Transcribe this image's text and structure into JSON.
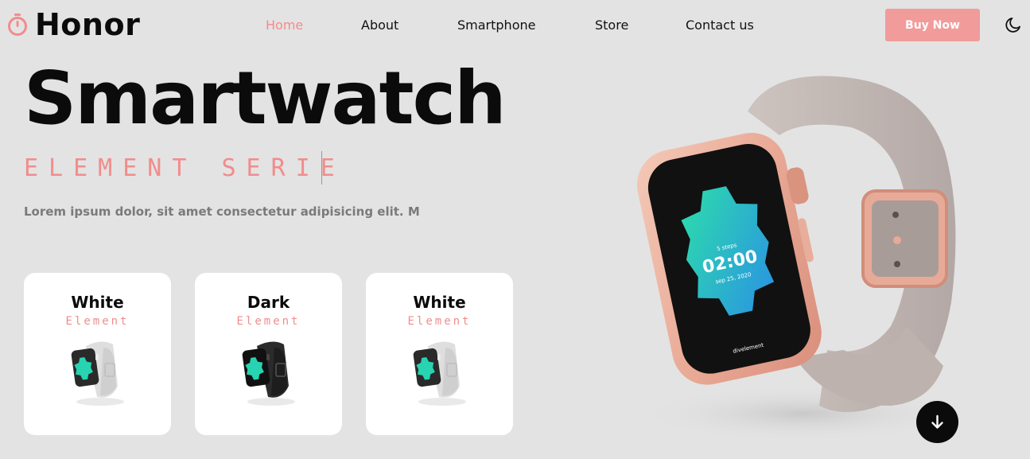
{
  "brand": {
    "name": "Honor",
    "accent": "#f28c8c"
  },
  "nav": {
    "items": [
      {
        "label": "Home",
        "active": true
      },
      {
        "label": "About",
        "active": false
      },
      {
        "label": "Smartphone",
        "active": false
      },
      {
        "label": "Store",
        "active": false
      },
      {
        "label": "Contact us",
        "active": false
      }
    ],
    "cta_label": "Buy Now",
    "theme_icon": "moon-icon"
  },
  "hero": {
    "title": "Smartwatch",
    "subtitle": "ELEMENT SERIE",
    "description": "Lorem ipsum dolor, sit amet consectetur adipisicing elit. M"
  },
  "cards": [
    {
      "title": "White",
      "subtitle": "Element",
      "band": "white"
    },
    {
      "title": "Dark",
      "subtitle": "Element",
      "band": "dark"
    },
    {
      "title": "White",
      "subtitle": "Element",
      "band": "white"
    }
  ],
  "watch": {
    "time": "02:00",
    "date": "sep 25, 2020",
    "steps": "5 steps",
    "brand_text": "divelement"
  },
  "scroll_icon": "arrow-down-icon"
}
